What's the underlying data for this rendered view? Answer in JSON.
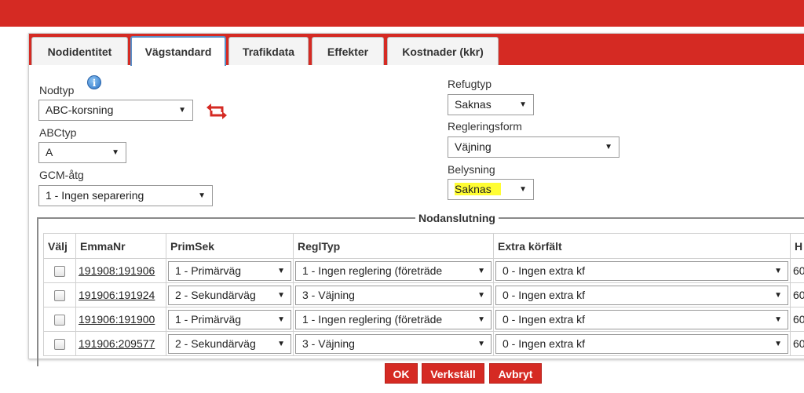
{
  "tabs": [
    {
      "label": "Nodidentitet"
    },
    {
      "label": "Vägstandard"
    },
    {
      "label": "Trafikdata"
    },
    {
      "label": "Effekter"
    },
    {
      "label": "Kostnader (kkr)"
    }
  ],
  "active_tab": "Vägstandard",
  "form": {
    "nodtyp": {
      "label": "Nodtyp",
      "value": "ABC-korsning"
    },
    "abctyp": {
      "label": "ABCtyp",
      "value": "A"
    },
    "gcm": {
      "label": "GCM-åtg",
      "value": "1 - Ingen separering"
    },
    "refugtyp": {
      "label": "Refugtyp",
      "value": "Saknas"
    },
    "regleringsform": {
      "label": "Regleringsform",
      "value": "Väjning"
    },
    "belysning": {
      "label": "Belysning",
      "value": "Saknas",
      "highlight_color": "#fffd33"
    }
  },
  "icons": {
    "info": "info-icon",
    "swap": "swap-icon",
    "dropdown": "▼"
  },
  "nodanslutning": {
    "legend": "Nodanslutning",
    "columns": [
      "Välj",
      "EmmaNr",
      "PrimSek",
      "ReglTyp",
      "Extra körfält",
      "H"
    ],
    "rows": [
      {
        "emma": "191908:191906",
        "primsek": "1 - Primärväg",
        "regltyp": "1 - Ingen reglering (företräde",
        "extra": "0 - Ingen extra kf",
        "h": "60"
      },
      {
        "emma": "191906:191924",
        "primsek": "2 - Sekundärväg",
        "regltyp": "3 - Väjning",
        "extra": "0 - Ingen extra kf",
        "h": "60"
      },
      {
        "emma": "191906:191900",
        "primsek": "1 - Primärväg",
        "regltyp": "1 - Ingen reglering (företräde",
        "extra": "0 - Ingen extra kf",
        "h": "60"
      },
      {
        "emma": "191906:209577",
        "primsek": "2 - Sekundärväg",
        "regltyp": "3 - Väjning",
        "extra": "0 - Ingen extra kf",
        "h": "60"
      }
    ]
  },
  "buttons": {
    "ok": "OK",
    "apply": "Verkställ",
    "cancel": "Avbryt"
  },
  "colors": {
    "brand_red": "#d52a23",
    "active_tab_border": "#5b8fc7"
  }
}
